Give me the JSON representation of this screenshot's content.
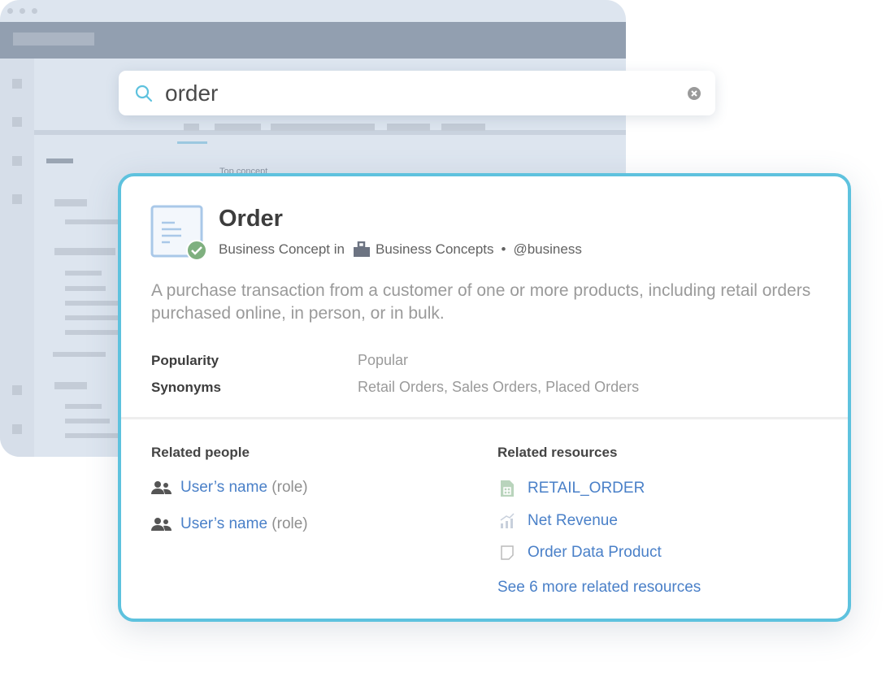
{
  "search": {
    "query": "order",
    "icon": "search-icon",
    "clear_icon": "clear-icon"
  },
  "background": {
    "faint_label": "Top concept"
  },
  "card": {
    "title": "Order",
    "type_prefix": "Business Concept in",
    "collection": "Business Concepts",
    "separator": "•",
    "owner": "@business",
    "description": "A purchase transaction from a customer of one or more products, including retail orders purchased online, in person, or in bulk.",
    "fields": [
      {
        "label": "Popularity",
        "value": "Popular"
      },
      {
        "label": "Synonyms",
        "value": "Retail Orders, Sales Orders, Placed Orders"
      }
    ],
    "related_people": {
      "heading": "Related people",
      "items": [
        {
          "name": "User’s name",
          "role": "(role)"
        },
        {
          "name": "User’s name",
          "role": "(role)"
        }
      ]
    },
    "related_resources": {
      "heading": "Related resources",
      "items": [
        {
          "name": "RETAIL_ORDER",
          "icon": "spreadsheet-icon"
        },
        {
          "name": "Net Revenue",
          "icon": "chart-icon"
        },
        {
          "name": "Order Data Product",
          "icon": "note-icon"
        }
      ],
      "more": "See 6 more related resources"
    }
  },
  "colors": {
    "accent": "#5ec2de",
    "link": "#4a80c8",
    "verified": "#7fb07f"
  }
}
